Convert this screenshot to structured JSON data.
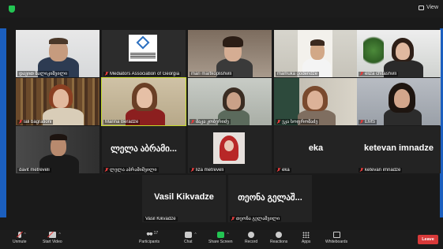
{
  "toolbar_top": {
    "view_label": "View"
  },
  "participants": [
    {
      "name": "დავით ზალიკიშვილი",
      "muted": false
    },
    {
      "name": "Mediators Association of Georgia",
      "muted": true
    },
    {
      "name": "mari martkoplishvili",
      "muted": false
    },
    {
      "name": "mamuka goderidze",
      "muted": false
    },
    {
      "name": "eliza chitashvili",
      "muted": true
    },
    {
      "name": "lali bagrationi",
      "muted": true
    },
    {
      "name": "Marina Beradze",
      "muted": false
    },
    {
      "name": "მაკა კობერიძე",
      "muted": true
    },
    {
      "name": "ეკა სოფრომაძე",
      "muted": true
    },
    {
      "name": "EMS",
      "muted": true
    },
    {
      "name": "davit metreveli",
      "muted": false
    },
    {
      "name": "ლელა აბრამიშვილი",
      "display": "ლელა აბრამი...",
      "muted": true
    },
    {
      "name": "liza metreveli",
      "muted": true
    },
    {
      "name": "eka",
      "display": "eka",
      "muted": true
    },
    {
      "name": "ketevan imnadze",
      "display": "ketevan imnadze",
      "muted": true
    },
    {
      "name": "Vasil Kikvadze",
      "display": "Vasil Kikvadze",
      "muted": false
    },
    {
      "name": "თეონა გელაშვილი",
      "display": "თეონა გელაშ...",
      "muted": true
    }
  ],
  "bottombar": {
    "unmute": "Unmute",
    "start_video": "Start Video",
    "participants": "Participants",
    "participants_count": "17",
    "chat": "Chat",
    "share_screen": "Share Screen",
    "record": "Record",
    "reactions": "Reactions",
    "apps": "Apps",
    "whiteboards": "Whiteboards",
    "leave": "Leave"
  }
}
